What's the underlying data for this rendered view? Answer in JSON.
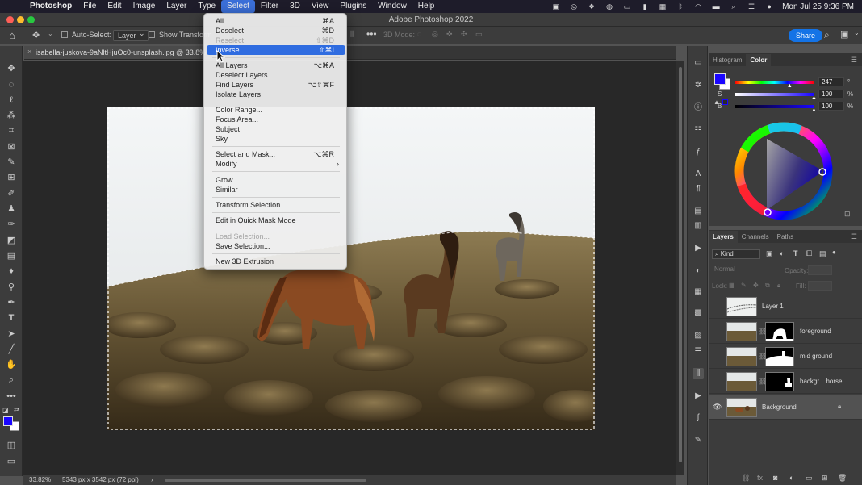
{
  "menubar": {
    "app": "Photoshop",
    "items": [
      "File",
      "Edit",
      "Image",
      "Layer",
      "Type",
      "Select",
      "Filter",
      "3D",
      "View",
      "Plugins",
      "Window",
      "Help"
    ],
    "active_item": "Select",
    "datetime": "Mon Jul 25  9:36 PM"
  },
  "window": {
    "title": "Adobe Photoshop 2022"
  },
  "options": {
    "auto_select_label": "Auto-Select:",
    "auto_select_value": "Layer",
    "show_transform_label": "Show Transform",
    "mode_label": "3D Mode:",
    "share_label": "Share"
  },
  "document": {
    "tab_title": "isabella-juskova-9aNltHjuOc0-unsplash.jpg @ 33.8%",
    "zoom": "33.82%",
    "dimensions": "5343 px x 3542 px (72 ppi)"
  },
  "select_menu": [
    {
      "label": "All",
      "shortcut": "⌘A",
      "state": "normal"
    },
    {
      "label": "Deselect",
      "shortcut": "⌘D",
      "state": "normal"
    },
    {
      "label": "Reselect",
      "shortcut": "⇧⌘D",
      "state": "disabled"
    },
    {
      "label": "Inverse",
      "shortcut": "⇧⌘I",
      "state": "highlight"
    },
    {
      "label": "All Layers",
      "shortcut": "⌥⌘A",
      "state": "normal"
    },
    {
      "label": "Deselect Layers",
      "shortcut": "",
      "state": "normal"
    },
    {
      "label": "Find Layers",
      "shortcut": "⌥⇧⌘F",
      "state": "normal"
    },
    {
      "label": "Isolate Layers",
      "shortcut": "",
      "state": "normal"
    },
    {
      "label": "Color Range...",
      "shortcut": "",
      "state": "normal"
    },
    {
      "label": "Focus Area...",
      "shortcut": "",
      "state": "normal"
    },
    {
      "label": "Subject",
      "shortcut": "",
      "state": "normal"
    },
    {
      "label": "Sky",
      "shortcut": "",
      "state": "normal"
    },
    {
      "label": "Select and Mask...",
      "shortcut": "⌥⌘R",
      "state": "normal"
    },
    {
      "label": "Modify",
      "shortcut": "",
      "state": "submenu"
    },
    {
      "label": "Grow",
      "shortcut": "",
      "state": "normal"
    },
    {
      "label": "Similar",
      "shortcut": "",
      "state": "normal"
    },
    {
      "label": "Transform Selection",
      "shortcut": "",
      "state": "normal"
    },
    {
      "label": "Edit in Quick Mask Mode",
      "shortcut": "",
      "state": "normal"
    },
    {
      "label": "Load Selection...",
      "shortcut": "",
      "state": "disabled"
    },
    {
      "label": "Save Selection...",
      "shortcut": "",
      "state": "normal"
    },
    {
      "label": "New 3D Extrusion",
      "shortcut": "",
      "state": "normal"
    }
  ],
  "color_panel": {
    "tabs": [
      "Histogram",
      "Color"
    ],
    "active_tab": "Color",
    "sliders": [
      {
        "label": "H",
        "value": "247",
        "unit": "°",
        "fraction": 0.69
      },
      {
        "label": "S",
        "value": "100",
        "unit": "%",
        "fraction": 1.0
      },
      {
        "label": "B",
        "value": "100",
        "unit": "%",
        "fraction": 1.0
      }
    ],
    "foreground_color": "#1a06ff",
    "background_color": "#ffffff"
  },
  "layers_panel": {
    "tabs": [
      "Layers",
      "Channels",
      "Paths"
    ],
    "active_tab": "Layers",
    "filter_kind": "Kind",
    "blend_mode": "Normal",
    "opacity_label": "Opacity:",
    "lock_label": "Lock:",
    "fill_label": "Fill:",
    "layers": [
      {
        "name": "Layer 1",
        "mask": false,
        "visible": false,
        "selected": false,
        "locked": false
      },
      {
        "name": "foreground",
        "mask": true,
        "visible": false,
        "selected": false,
        "locked": false
      },
      {
        "name": "mid ground",
        "mask": true,
        "visible": false,
        "selected": false,
        "locked": false
      },
      {
        "name": "backgr... horse",
        "mask": true,
        "visible": false,
        "selected": false,
        "locked": false
      },
      {
        "name": "Background",
        "mask": false,
        "visible": true,
        "selected": true,
        "locked": true
      }
    ]
  },
  "tools": [
    "move-icon",
    "marquee-icon",
    "lasso-icon",
    "magic-wand-icon",
    "crop-icon",
    "frame-icon",
    "eyedropper-icon",
    "healing-icon",
    "brush-icon",
    "stamp-icon",
    "history-brush-icon",
    "eraser-icon",
    "gradient-icon",
    "blur-icon",
    "dodge-icon",
    "pen-icon",
    "type-icon",
    "path-select-icon",
    "line-icon",
    "hand-icon",
    "zoom-icon",
    "more-tools-icon"
  ]
}
